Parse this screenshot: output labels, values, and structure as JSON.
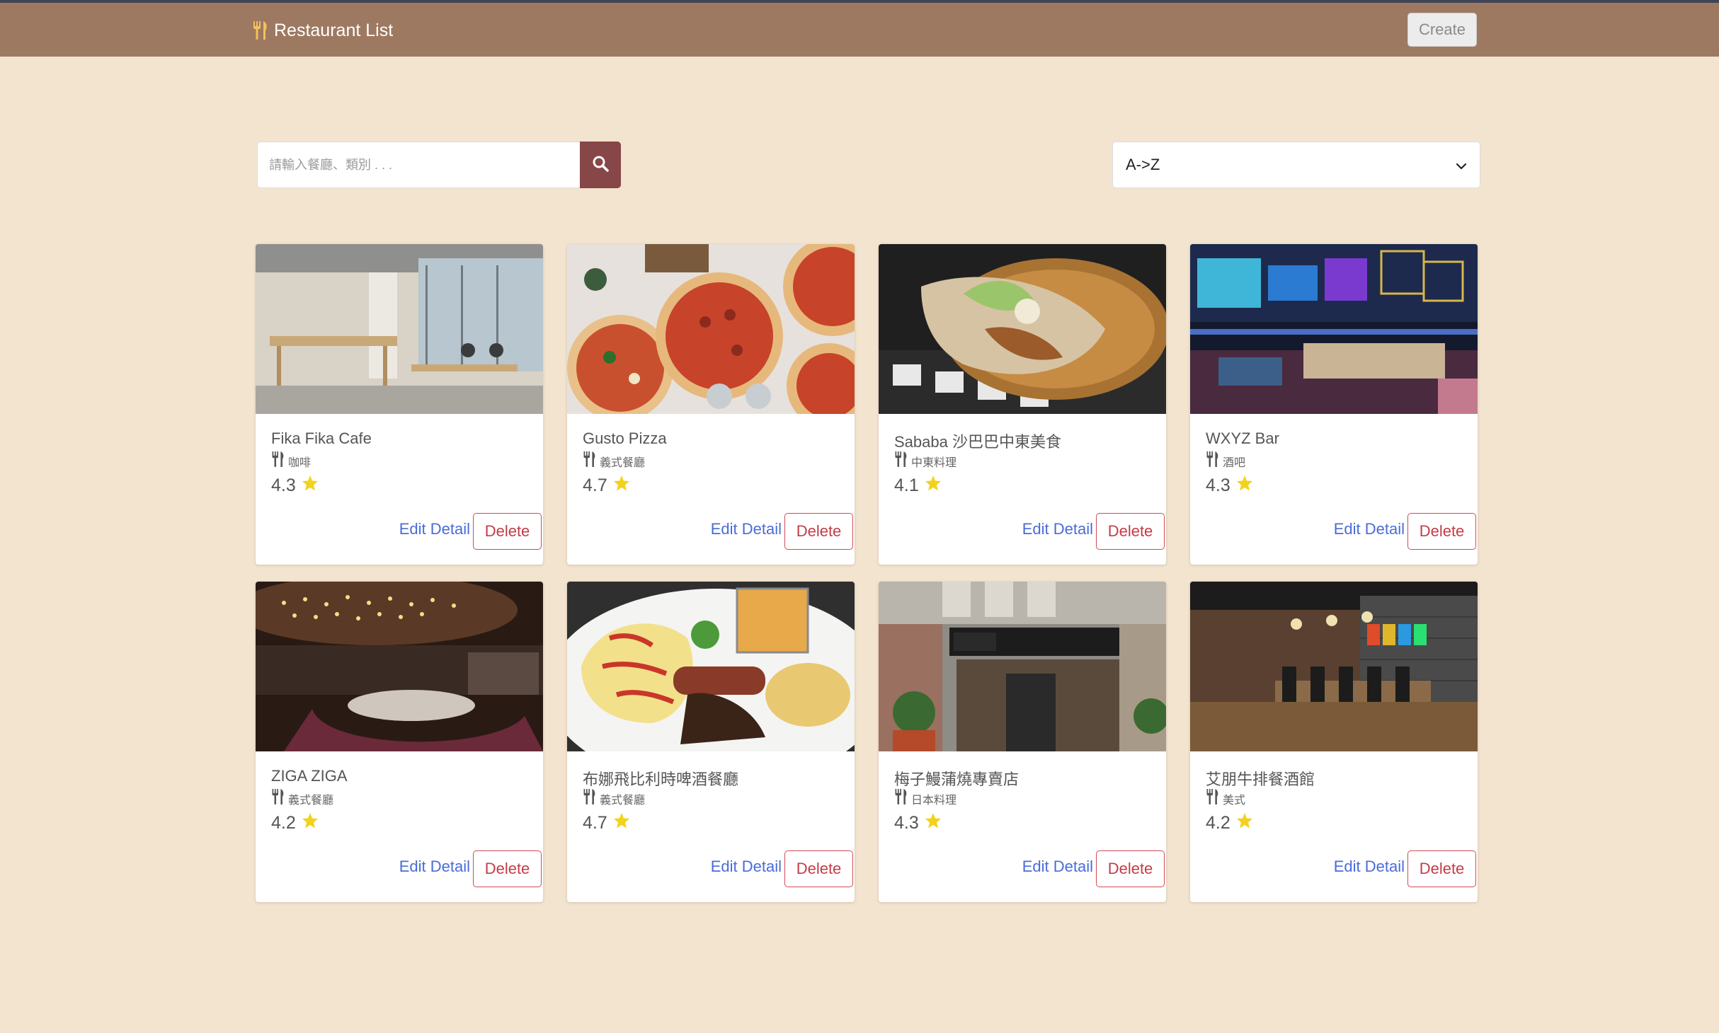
{
  "navbar": {
    "brand": "Restaurant List",
    "create_label": "Create"
  },
  "search": {
    "placeholder": "請輸入餐廳、類別 . . ."
  },
  "sort": {
    "selected": "A->Z"
  },
  "actions": {
    "edit_label": "Edit Detail",
    "delete_label": "Delete"
  },
  "restaurants": [
    {
      "name": "Fika Fika Cafe",
      "category": "咖啡",
      "rating": "4.3"
    },
    {
      "name": "Gusto Pizza",
      "category": "義式餐廳",
      "rating": "4.7"
    },
    {
      "name": "Sababa 沙巴巴中東美食",
      "category": "中東料理",
      "rating": "4.1"
    },
    {
      "name": "WXYZ Bar",
      "category": "酒吧",
      "rating": "4.3"
    },
    {
      "name": "ZIGA ZIGA",
      "category": "義式餐廳",
      "rating": "4.2"
    },
    {
      "name": "布娜飛比利時啤酒餐廳",
      "category": "義式餐廳",
      "rating": "4.7"
    },
    {
      "name": "梅子鰻蒲燒專賣店",
      "category": "日本料理",
      "rating": "4.3"
    },
    {
      "name": "艾朋牛排餐酒館",
      "category": "美式",
      "rating": "4.2"
    }
  ]
}
